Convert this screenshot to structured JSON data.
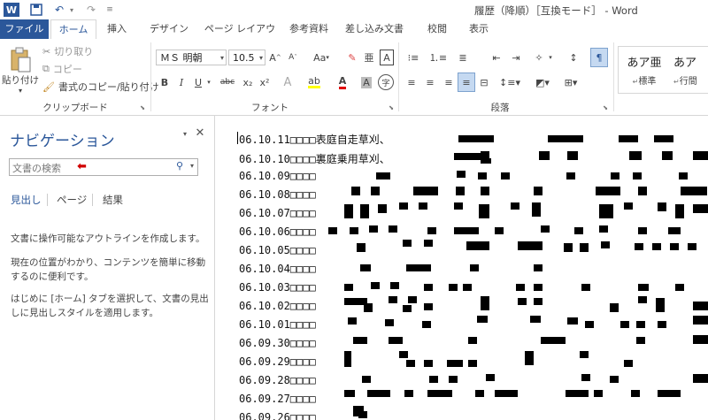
{
  "window": {
    "title": "履歴（降順）［互換モード］ - Word",
    "app_icon": "W"
  },
  "tabs": [
    {
      "label": "ファイル"
    },
    {
      "label": "ホーム"
    },
    {
      "label": "挿入"
    },
    {
      "label": "デザイン"
    },
    {
      "label": "ページ レイアウト"
    },
    {
      "label": "参考資料"
    },
    {
      "label": "差し込み文書"
    },
    {
      "label": "校閲"
    },
    {
      "label": "表示"
    }
  ],
  "ribbon": {
    "clipboard": {
      "paste": "貼り付け",
      "cut": "切り取り",
      "copy": "コピー",
      "format_painter": "書式のコピー/貼り付け",
      "group": "クリップボード"
    },
    "font": {
      "name": "ＭＳ 明朝",
      "size": "10.5",
      "group": "フォント",
      "bold": "B",
      "italic": "I",
      "underline": "U",
      "strike": "abc",
      "sub": "x₂",
      "sup": "x²",
      "grow": "Aˆ",
      "shrink": "Aˇ",
      "case": "Aa",
      "clear": "A",
      "A_box": "A",
      "circled": "字"
    },
    "paragraph": {
      "group": "段落"
    },
    "styles": {
      "style1_preview": "あア亜",
      "style1_name": "標準",
      "style2_preview": "あア",
      "style2_name": "行間"
    }
  },
  "nav": {
    "title": "ナビゲーション",
    "search_placeholder": "文書の検索",
    "tabs": [
      {
        "label": "見出し"
      },
      {
        "label": "ページ"
      },
      {
        "label": "結果"
      }
    ],
    "text1": "文書に操作可能なアウトラインを作成します。",
    "text2": "現在の位置がわかり、コンテンツを簡単に移動するのに便利です。",
    "text3": "はじめに [ホーム] タブを選択して、文書の見出しに見出しスタイルを適用します。"
  },
  "doc": {
    "lines": [
      "06.10.11□□□□表庭自走草刈、",
      "06.10.10□□□□裏庭乗用草刈、",
      "06.10.09□□□□",
      "06.10.08□□□□",
      "06.10.07□□□□",
      "06.10.06□□□□",
      "06.10.05□□□□",
      "06.10.04□□□□",
      "06.10.03□□□□",
      "06.10.02□□□□",
      "06.10.01□□□□",
      "06.09.30□□□□",
      "06.09.29□□□□",
      "06.09.28□□□□",
      "06.09.27□□□□",
      "06.09.26□□□□"
    ]
  }
}
